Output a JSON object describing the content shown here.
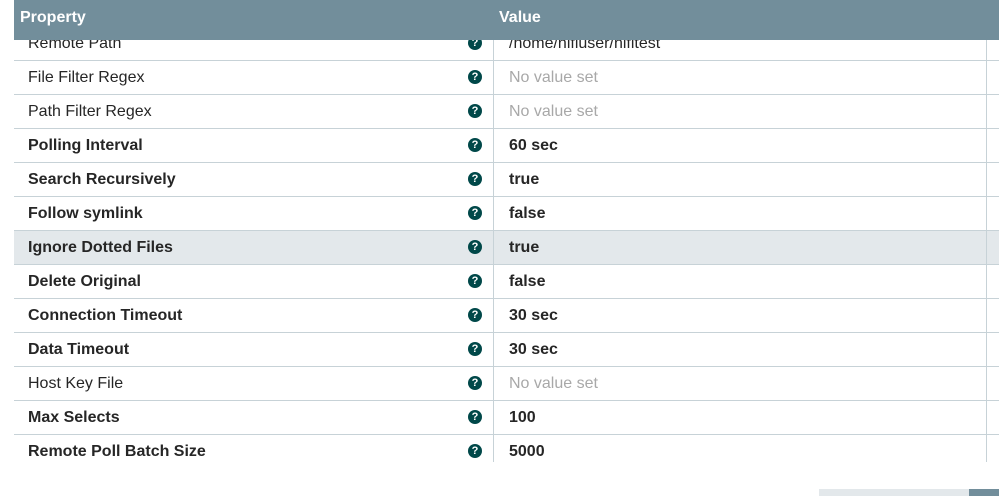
{
  "header": {
    "property_label": "Property",
    "value_label": "Value"
  },
  "rows": [
    {
      "name": "Remote Path",
      "value": "/home/nifiuser/nifitest",
      "required": false,
      "unset": false
    },
    {
      "name": "File Filter Regex",
      "value": "No value set",
      "required": false,
      "unset": true
    },
    {
      "name": "Path Filter Regex",
      "value": "No value set",
      "required": false,
      "unset": true
    },
    {
      "name": "Polling Interval",
      "value": "60 sec",
      "required": true,
      "unset": false
    },
    {
      "name": "Search Recursively",
      "value": "true",
      "required": true,
      "unset": false
    },
    {
      "name": "Follow symlink",
      "value": "false",
      "required": true,
      "unset": false
    },
    {
      "name": "Ignore Dotted Files",
      "value": "true",
      "required": true,
      "unset": false,
      "selected": true
    },
    {
      "name": "Delete Original",
      "value": "false",
      "required": true,
      "unset": false
    },
    {
      "name": "Connection Timeout",
      "value": "30 sec",
      "required": true,
      "unset": false
    },
    {
      "name": "Data Timeout",
      "value": "30 sec",
      "required": true,
      "unset": false
    },
    {
      "name": "Host Key File",
      "value": "No value set",
      "required": false,
      "unset": true
    },
    {
      "name": "Max Selects",
      "value": "100",
      "required": true,
      "unset": false
    },
    {
      "name": "Remote Poll Batch Size",
      "value": "5000",
      "required": true,
      "unset": false
    }
  ],
  "help_icon_glyph": "?",
  "colors": {
    "header_bg": "#728e9b",
    "help_icon": "#004849",
    "selected_row": "#e3e8eb",
    "unset_value": "#a8a8a8"
  }
}
